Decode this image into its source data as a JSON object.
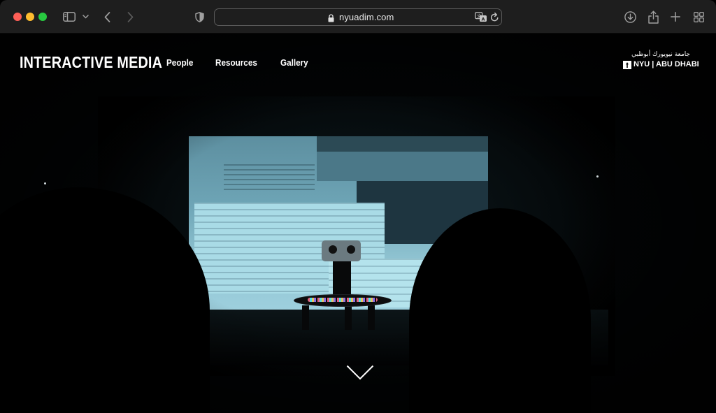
{
  "browser": {
    "url": "nyuadim.com",
    "icons": {
      "sidebar": "sidebar-icon",
      "sidebar_menu": "chevron-down-icon",
      "back": "back-icon",
      "forward": "forward-icon",
      "privacy": "shield-icon",
      "lock": "lock-icon",
      "translate": "translate-icon",
      "reload": "reload-icon",
      "download": "download-icon",
      "share": "share-icon",
      "new_tab": "plus-icon",
      "tab_overview": "tab-overview-icon"
    },
    "colors": {
      "close": "#fe5f57",
      "minimize": "#febc2e",
      "zoom": "#28c840"
    }
  },
  "site": {
    "brand": "INTERACTIVE MEDIA",
    "nav": [
      {
        "label": "People"
      },
      {
        "label": "Resources"
      },
      {
        "label": "Gallery"
      }
    ],
    "logo": {
      "arabic": "جامعة نيويورك أبوظبي",
      "latin": "NYU | ABU DHABI"
    },
    "scroll_icon": "chevron-down-icon"
  }
}
